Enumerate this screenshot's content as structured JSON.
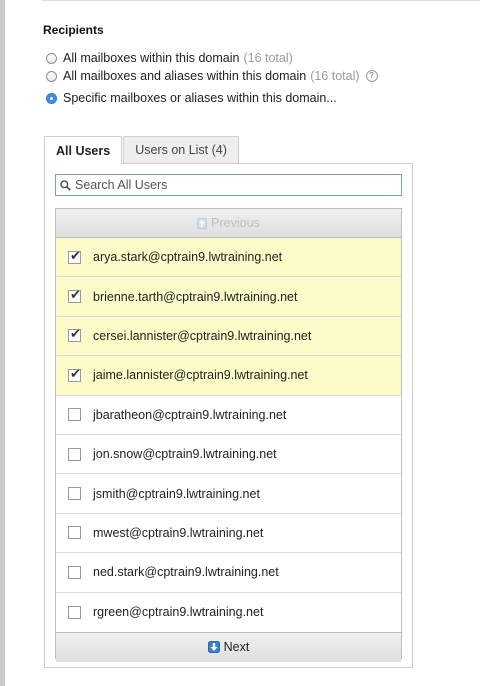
{
  "recipients": {
    "title": "Recipients",
    "options": [
      {
        "label": "All mailboxes within this domain",
        "count": "(16 total)",
        "checked": false
      },
      {
        "label": "All mailboxes and aliases within this domain",
        "count": "(16 total)",
        "checked": false
      },
      {
        "label": "Specific mailboxes or aliases within this domain...",
        "count": "",
        "checked": true
      }
    ]
  },
  "tabs": [
    {
      "label": "All Users",
      "active": true
    },
    {
      "label": "Users on List (4)",
      "active": false
    }
  ],
  "search": {
    "placeholder": "Search All Users",
    "value": ""
  },
  "pager": {
    "previous_label": "Previous",
    "next_label": "Next"
  },
  "users": [
    {
      "email": "arya.stark@cptrain9.lwtraining.net",
      "checked": true
    },
    {
      "email": "brienne.tarth@cptrain9.lwtraining.net",
      "checked": true
    },
    {
      "email": "cersei.lannister@cptrain9.lwtraining.net",
      "checked": true
    },
    {
      "email": "jaime.lannister@cptrain9.lwtraining.net",
      "checked": true
    },
    {
      "email": "jbaratheon@cptrain9.lwtraining.net",
      "checked": false
    },
    {
      "email": "jon.snow@cptrain9.lwtraining.net",
      "checked": false
    },
    {
      "email": "jsmith@cptrain9.lwtraining.net",
      "checked": false
    },
    {
      "email": "mwest@cptrain9.lwtraining.net",
      "checked": false
    },
    {
      "email": "ned.stark@cptrain9.lwtraining.net",
      "checked": false
    },
    {
      "email": "rgreen@cptrain9.lwtraining.net",
      "checked": false
    }
  ],
  "colors": {
    "accent": "#3b8ee6",
    "selected_row": "#fcfcc9"
  }
}
